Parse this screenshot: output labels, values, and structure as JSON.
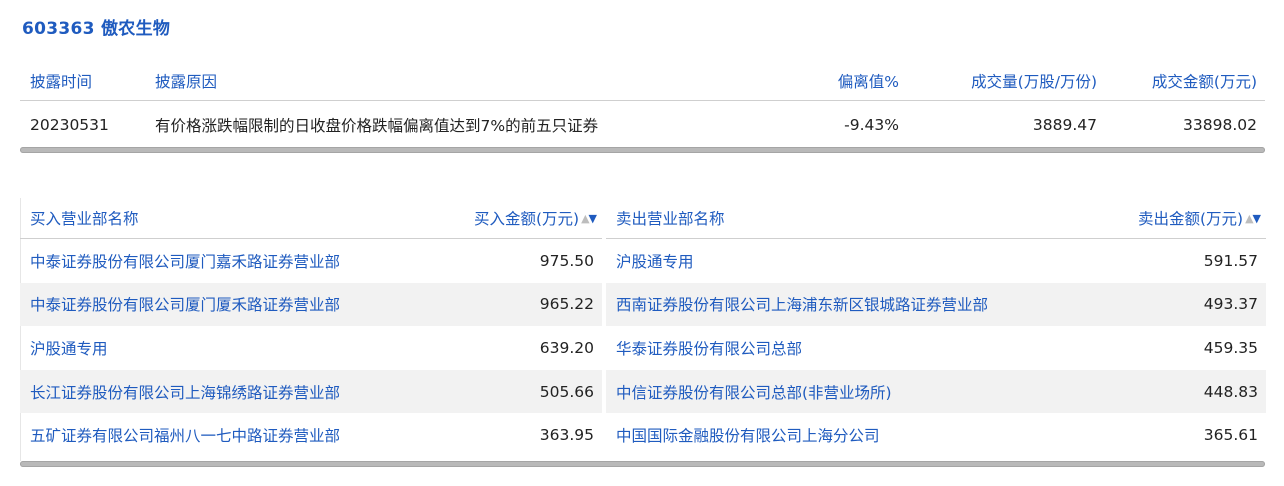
{
  "header": {
    "title": "603363 傲农生物"
  },
  "disclosure": {
    "columns": [
      "披露时间",
      "披露原因",
      "偏离值%",
      "成交量(万股/万份)",
      "成交金额(万元)"
    ],
    "row": {
      "date": "20230531",
      "reason": "有价格涨跌幅限制的日收盘价格跌幅偏离值达到7%的前五只证券",
      "deviation": "-9.43%",
      "volume": "3889.47",
      "amount": "33898.02"
    }
  },
  "buy": {
    "name_header": "买入营业部名称",
    "amount_header": "买入金额(万元)",
    "rows": [
      {
        "name": "中泰证券股份有限公司厦门嘉禾路证券营业部",
        "amount": "975.50"
      },
      {
        "name": "中泰证券股份有限公司厦门厦禾路证券营业部",
        "amount": "965.22"
      },
      {
        "name": "沪股通专用",
        "amount": "639.20"
      },
      {
        "name": "长江证券股份有限公司上海锦绣路证券营业部",
        "amount": "505.66"
      },
      {
        "name": "五矿证券有限公司福州八一七中路证券营业部",
        "amount": "363.95"
      }
    ]
  },
  "sell": {
    "name_header": "卖出营业部名称",
    "amount_header": "卖出金额(万元)",
    "rows": [
      {
        "name": "沪股通专用",
        "amount": "591.57"
      },
      {
        "name": "西南证券股份有限公司上海浦东新区银城路证券营业部",
        "amount": "493.37"
      },
      {
        "name": "华泰证券股份有限公司总部",
        "amount": "459.35"
      },
      {
        "name": "中信证券股份有限公司总部(非营业场所)",
        "amount": "448.83"
      },
      {
        "name": "中国国际金融股份有限公司上海分公司",
        "amount": "365.61"
      }
    ]
  },
  "icons": {
    "sort": "sort-toggle-icon"
  },
  "colors": {
    "accent": "#1f5bbf",
    "row_alt": "#f2f2f2"
  }
}
